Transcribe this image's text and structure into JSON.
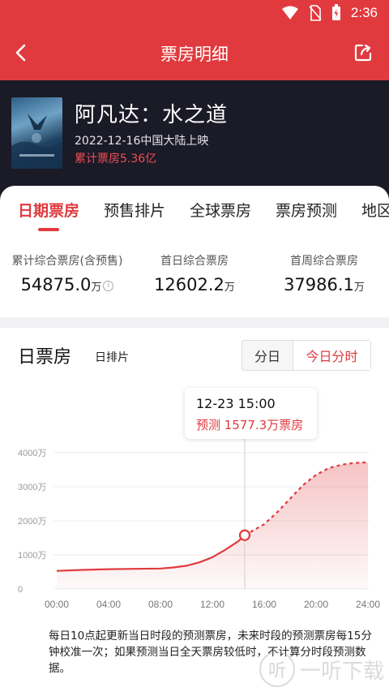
{
  "status_bar": {
    "time": "2:36"
  },
  "app_bar": {
    "title": "票房明细"
  },
  "movie": {
    "title": "阿凡达：水之道",
    "release": "2022-12-16中国大陆上映",
    "total_label": "累计票房",
    "total_value": "5.36亿"
  },
  "tabs": [
    "日期票房",
    "预售排片",
    "全球票房",
    "票房预测",
    "地区"
  ],
  "stats": [
    {
      "label": "累计综合票房(含预售)",
      "value": "54875.0",
      "unit": "万"
    },
    {
      "label": "首日综合票房",
      "value": "12602.2",
      "unit": "万"
    },
    {
      "label": "首周综合票房",
      "value": "37986.1",
      "unit": "万"
    }
  ],
  "chart_section": {
    "heading": "日票房",
    "sub": "日排片",
    "toggle": [
      "分日",
      "今日分时"
    ],
    "tooltip_time": "12-23 15:00",
    "tooltip_text": "预测 1577.3万票房",
    "note": "每日10点起更新当日时段的预测票房，未来时段的预测票房每15分钟校准一次；如果预测当日全天票房较低时，不计算分时段预测数据。"
  },
  "colors": {
    "accent": "#e03a3e",
    "header_bg": "#1b1a27"
  },
  "watermark": {
    "text": "一听下载",
    "logo": "听"
  },
  "chart_data": {
    "type": "area",
    "x_tick_labels": [
      "00:00",
      "04:00",
      "08:00",
      "12:00",
      "16:00",
      "20:00",
      "24:00"
    ],
    "y_tick_labels": [
      "0",
      "1000万",
      "2000万",
      "3000万",
      "4000万"
    ],
    "ylim": [
      0,
      4000
    ],
    "xlim": [
      0,
      24
    ],
    "series": [
      {
        "values": [
          [
            0,
            530
          ],
          [
            2,
            560
          ],
          [
            4,
            580
          ],
          [
            6,
            590
          ],
          [
            8,
            600
          ],
          [
            9,
            630
          ],
          [
            10,
            680
          ],
          [
            11,
            780
          ],
          [
            12,
            930
          ],
          [
            13,
            1150
          ],
          [
            14,
            1400
          ],
          [
            14.5,
            1577
          ]
        ]
      },
      {
        "values": [
          [
            14.5,
            1577
          ],
          [
            16,
            1900
          ],
          [
            17,
            2250
          ],
          [
            18,
            2650
          ],
          [
            19,
            3050
          ],
          [
            20,
            3350
          ],
          [
            21,
            3550
          ],
          [
            22,
            3650
          ],
          [
            23,
            3700
          ],
          [
            24,
            3720
          ]
        ]
      }
    ],
    "marker_x": 14.5,
    "marker_y": 1577.3
  }
}
